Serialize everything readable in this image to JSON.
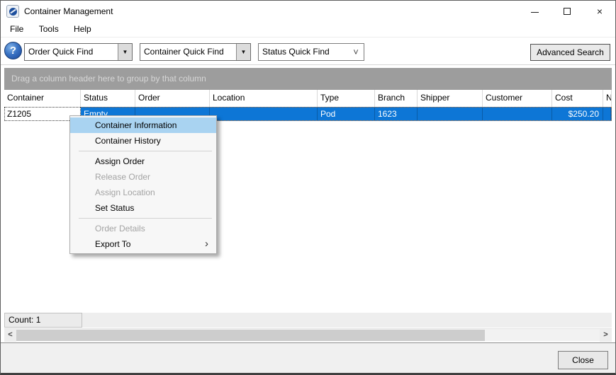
{
  "window": {
    "title": "Container Management"
  },
  "icons": {
    "help": "?",
    "dropdown_arrow": "▼",
    "native_chevron": "˅",
    "submenu_arrow": "›",
    "scroll_left": "<",
    "scroll_right": ">",
    "close": "×"
  },
  "menu_bar": {
    "items": [
      "File",
      "Tools",
      "Help"
    ]
  },
  "toolbar": {
    "quick_finds": [
      {
        "label": "Order Quick Find"
      },
      {
        "label": "Container Quick Find"
      },
      {
        "label": "Status Quick Find"
      }
    ],
    "advanced_search": "Advanced Search"
  },
  "grid": {
    "group_hint": "Drag a column header here to group by that column",
    "columns": [
      "Container",
      "Status",
      "Order",
      "Location",
      "Type",
      "Branch",
      "Shipper",
      "Customer",
      "Cost",
      "N"
    ],
    "row": {
      "cells": [
        "Z1205",
        "Empty",
        "",
        "",
        "Pod",
        "1623",
        "",
        "",
        "$250.20",
        ""
      ],
      "selected": true
    }
  },
  "context_menu": {
    "items": [
      {
        "label": "Container Information",
        "state": "highlighted"
      },
      {
        "label": "Container History",
        "state": "enabled"
      },
      {
        "type": "separator"
      },
      {
        "label": "Assign Order",
        "state": "enabled"
      },
      {
        "label": "Release Order",
        "state": "disabled"
      },
      {
        "label": "Assign Location",
        "state": "disabled"
      },
      {
        "label": "Set Status",
        "state": "enabled"
      },
      {
        "type": "separator"
      },
      {
        "label": "Order Details",
        "state": "disabled"
      },
      {
        "label": "Export To",
        "state": "enabled",
        "has_submenu": true
      }
    ]
  },
  "status_bar": {
    "count": "Count: 1"
  },
  "footer": {
    "close": "Close"
  },
  "colors": {
    "selection_blue": "#0d76d6",
    "menu_highlight": "#a9d3f1",
    "group_bar_gray": "#9d9d9d"
  }
}
